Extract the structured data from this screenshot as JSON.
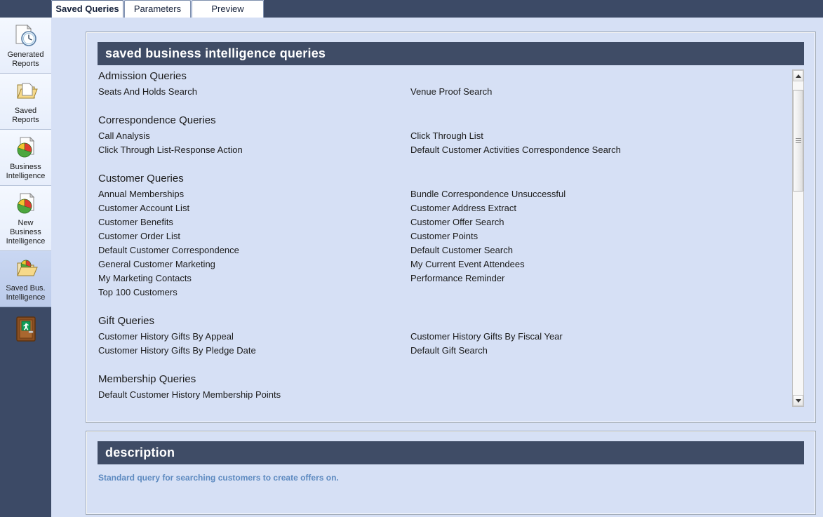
{
  "tabs": [
    {
      "label": "Saved Queries",
      "active": true
    },
    {
      "label": "Parameters",
      "active": false
    },
    {
      "label": "Preview",
      "active": false
    }
  ],
  "sidebar": {
    "items": [
      {
        "label": "Generated\nReports",
        "icon": "generated-reports-icon",
        "selected": false
      },
      {
        "label": "Saved Reports",
        "icon": "saved-reports-folder-icon",
        "selected": false
      },
      {
        "label": "Business\nIntelligence",
        "icon": "business-intelligence-icon",
        "selected": false
      },
      {
        "label": "New Business\nIntelligence",
        "icon": "new-business-intelligence-icon",
        "selected": false
      },
      {
        "label": "Saved Bus.\nIntelligence",
        "icon": "saved-business-intelligence-folder-icon",
        "selected": true
      }
    ],
    "exit": {
      "icon": "exit-door-icon",
      "label": ""
    }
  },
  "queries_panel": {
    "title": "saved business intelligence queries",
    "groups": [
      {
        "title": "Admission Queries",
        "rows": [
          {
            "left": "Seats And Holds Search",
            "right": "Venue Proof Search"
          }
        ]
      },
      {
        "title": "Correspondence Queries",
        "rows": [
          {
            "left": "Call Analysis",
            "right": "Click Through List"
          },
          {
            "left": "Click Through List-Response Action",
            "right": "Default Customer Activities Correspondence Search"
          }
        ]
      },
      {
        "title": "Customer Queries",
        "rows": [
          {
            "left": "Annual Memberships",
            "right": "Bundle Correspondence Unsuccessful"
          },
          {
            "left": "Customer Account List",
            "right": "Customer Address Extract"
          },
          {
            "left": "Customer Benefits",
            "right": "Customer Offer Search"
          },
          {
            "left": "Customer Order List",
            "right": "Customer Points"
          },
          {
            "left": "Default Customer Correspondence",
            "right": "Default Customer Search"
          },
          {
            "left": "General Customer Marketing",
            "right": "My Current Event Attendees"
          },
          {
            "left": "My Marketing Contacts",
            "right": "Performance Reminder"
          },
          {
            "left": "Top 100 Customers",
            "right": ""
          }
        ]
      },
      {
        "title": "Gift Queries",
        "rows": [
          {
            "left": "Customer History Gifts By Appeal",
            "right": "Customer History Gifts By Fiscal Year"
          },
          {
            "left": "Customer History Gifts By Pledge Date",
            "right": "Default Gift Search"
          }
        ]
      },
      {
        "title": "Membership Queries",
        "rows": [
          {
            "left": "Default Customer History Membership Points",
            "right": ""
          }
        ]
      }
    ]
  },
  "description_panel": {
    "title": "description",
    "text": "Standard query for searching customers to create offers on."
  },
  "colors": {
    "header_bar": "#3f4c66",
    "panel_background": "#d6e0f5",
    "app_background": "#d6e0f5",
    "sidebar_dark": "#3c4a66",
    "description_text": "#5d8ac0"
  }
}
